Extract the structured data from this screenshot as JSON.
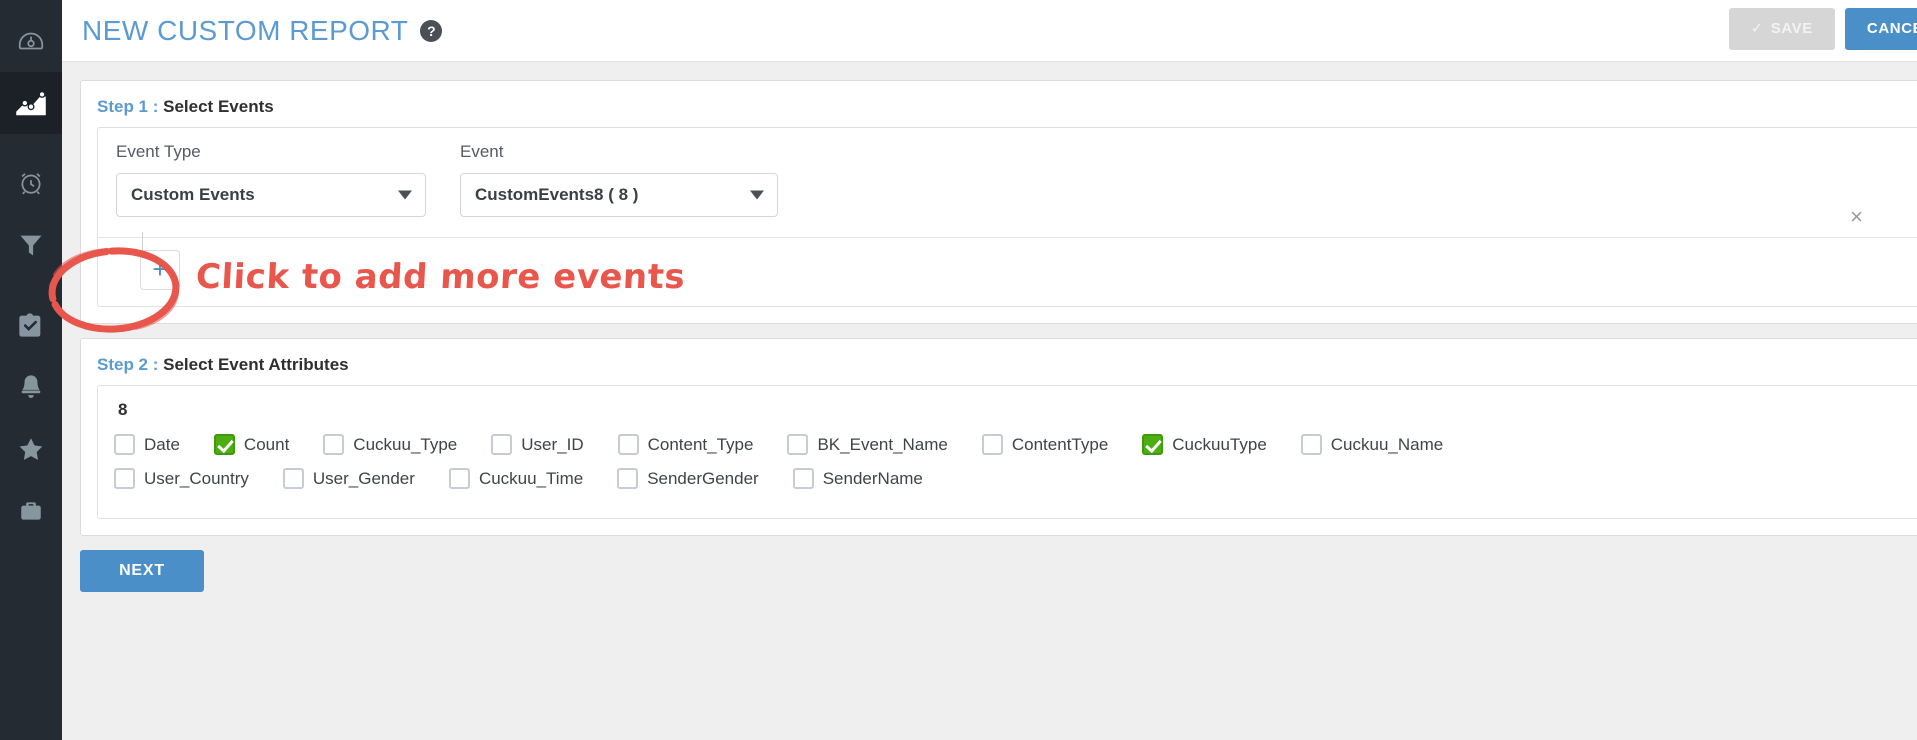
{
  "header": {
    "title": "NEW CUSTOM REPORT",
    "help_icon": "question-mark-icon",
    "save_label": "SAVE",
    "save_check": "✓",
    "cancel_label": "CANCEL",
    "title_color": "#5b9bd1",
    "cancel_color": "#4a8fc8",
    "save_color": "#d6d6d6"
  },
  "sidebar": {
    "items": [
      {
        "name": "dashboard-icon",
        "active": false
      },
      {
        "name": "analytics-chart-icon",
        "active": true
      },
      {
        "name": "alarm-clock-icon",
        "active": false
      },
      {
        "name": "funnel-filter-icon",
        "active": false
      },
      {
        "name": "clipboard-check-icon",
        "active": false
      },
      {
        "name": "bell-notification-icon",
        "active": false
      },
      {
        "name": "star-favorite-icon",
        "active": false
      },
      {
        "name": "briefcase-icon",
        "active": false
      }
    ]
  },
  "step1": {
    "step_label": "Step 1 :",
    "title": " Select Events",
    "event_type_label": "Event Type",
    "event_label": "Event",
    "event_type_value": "Custom Events",
    "event_value": "CustomEvents8 ( 8 )",
    "close_icon": "×",
    "add_icon": "+"
  },
  "step2": {
    "step_label": "Step 2 :",
    "title": " Select Event Attributes",
    "group_count": "8",
    "rows": [
      [
        {
          "label": "Date",
          "checked": false
        },
        {
          "label": "Count",
          "checked": true
        },
        {
          "label": "Cuckuu_Type",
          "checked": false
        },
        {
          "label": "User_ID",
          "checked": false
        },
        {
          "label": "Content_Type",
          "checked": false
        },
        {
          "label": "BK_Event_Name",
          "checked": false
        },
        {
          "label": "ContentType",
          "checked": false
        },
        {
          "label": "CuckuuType",
          "checked": true
        },
        {
          "label": "Cuckuu_Name",
          "checked": false
        }
      ],
      [
        {
          "label": "User_Country",
          "checked": false
        },
        {
          "label": "User_Gender",
          "checked": false
        },
        {
          "label": "Cuckuu_Time",
          "checked": false
        },
        {
          "label": "SenderGender",
          "checked": false
        },
        {
          "label": "SenderName",
          "checked": false
        }
      ]
    ],
    "checked_color": "#4caf11"
  },
  "footer": {
    "next_label": "NEXT"
  },
  "annotation": {
    "text": "Click to add more events",
    "color": "#e8564c",
    "circle_target": "add-event-button"
  }
}
